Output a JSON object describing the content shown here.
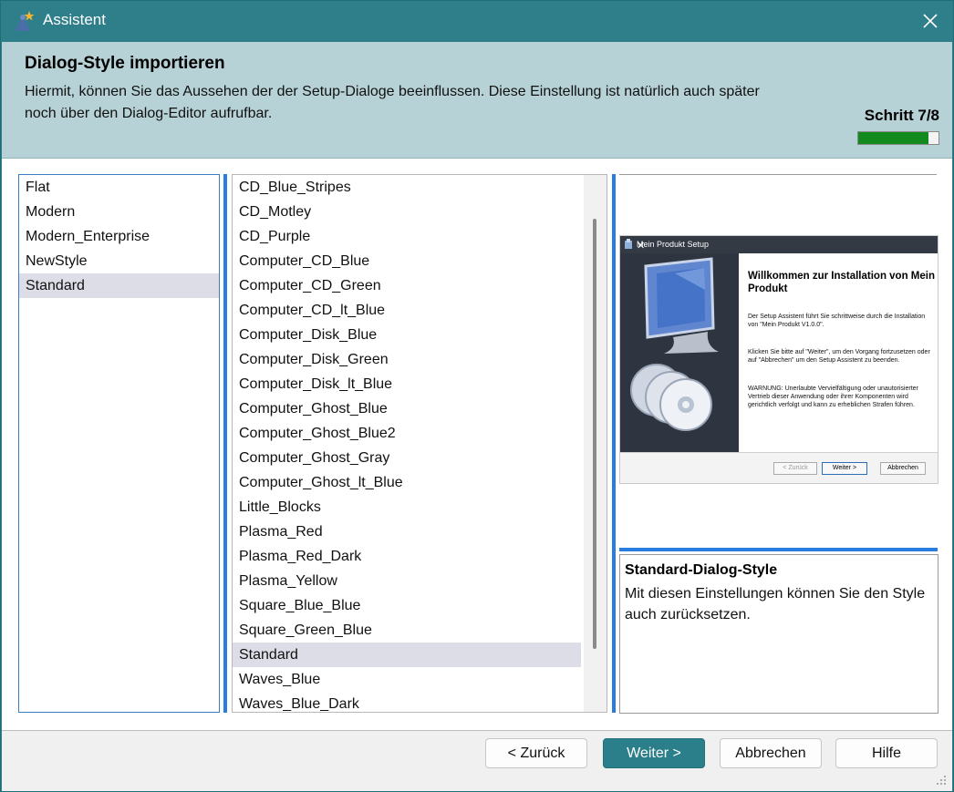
{
  "window": {
    "title": "Assistent"
  },
  "header": {
    "title": "Dialog-Style importieren",
    "description": "Hiermit, können Sie das Aussehen der der Setup-Dialoge beeinflussen. Diese Einstellung ist natürlich auch später noch über den Dialog-Editor aufrufbar.",
    "step_label": "Schritt 7/8",
    "progress": 0.875
  },
  "categories": {
    "items": [
      "Flat",
      "Modern",
      "Modern_Enterprise",
      "NewStyle",
      "Standard"
    ],
    "selected": "Standard"
  },
  "styles": {
    "items": [
      "CD_Blue_Stripes",
      "CD_Motley",
      "CD_Purple",
      "Computer_CD_Blue",
      "Computer_CD_Green",
      "Computer_CD_lt_Blue",
      "Computer_Disk_Blue",
      "Computer_Disk_Green",
      "Computer_Disk_lt_Blue",
      "Computer_Ghost_Blue",
      "Computer_Ghost_Blue2",
      "Computer_Ghost_Gray",
      "Computer_Ghost_lt_Blue",
      "Little_Blocks",
      "Plasma_Red",
      "Plasma_Red_Dark",
      "Plasma_Yellow",
      "Square_Blue_Blue",
      "Square_Green_Blue",
      "Standard",
      "Waves_Blue",
      "Waves_Blue_Dark"
    ],
    "selected": "Standard"
  },
  "preview": {
    "window_title": "Mein Produkt Setup",
    "heading": "Willkommen zur Installation von Mein Produkt",
    "para1": "Der Setup Assistent führt Sie schrittweise durch die Installation von \"Mein Produkt V1.0.0\".",
    "para2": "Klicken Sie bitte auf \"Weiter\", um den Vorgang fortzusetzen oder auf \"Abbrechen\" um den Setup Assistent zu beenden.",
    "para3": "WARNUNG: Unerlaubte Vervielfältigung oder unautorisierter Vertrieb dieser Anwendung oder ihrer Komponenten wird gerichtlich verfolgt und kann zu erheblichen Strafen führen.",
    "btn_back": "< Zurück",
    "btn_next": "Weiter >",
    "btn_cancel": "Abbrechen"
  },
  "style_info": {
    "title": "Standard-Dialog-Style",
    "text": "Mit diesen Einstellungen können Sie den Style auch zurücksetzen."
  },
  "footer": {
    "back": "< Zurück",
    "next": "Weiter >",
    "cancel": "Abbrechen",
    "help": "Hilfe"
  },
  "colors": {
    "accent": "#2b7f8a",
    "header_bg": "#b6d2d6",
    "progress": "#138a1e",
    "selection": "#dcdde6",
    "splitter": "#2a7de0"
  }
}
